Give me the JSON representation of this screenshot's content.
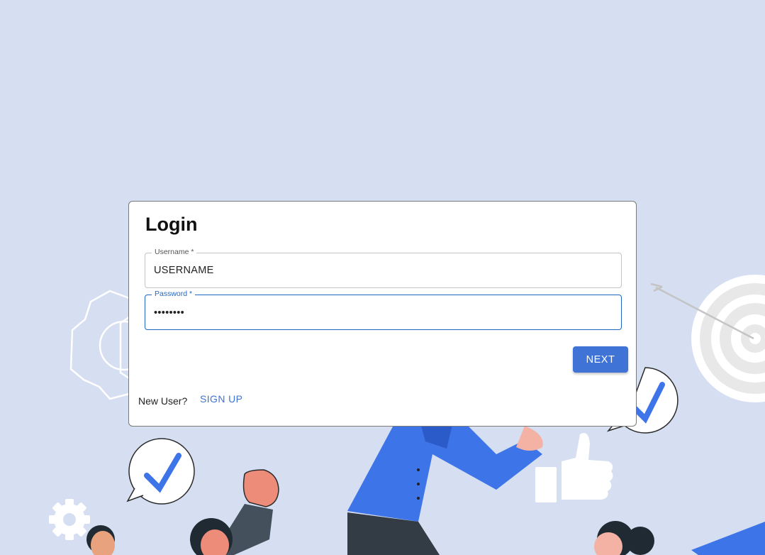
{
  "colors": {
    "background": "#d6def2",
    "accent": "#3f74d6",
    "focus": "#1f66c4",
    "card": "#ffffff",
    "shirt": "#3d74e8"
  },
  "login": {
    "title": "Login",
    "username": {
      "label": "Username *",
      "value": "USERNAME"
    },
    "password": {
      "label": "Password *",
      "value": "••••••••"
    },
    "next_label": "NEXT",
    "new_user_text": "New User?",
    "signup_label": "SIGN UP"
  },
  "illustration": {
    "icons": [
      "gear-icon",
      "target-icon",
      "arrow-icon",
      "check-bubble-icon",
      "thumbs-up-icon",
      "person-icon",
      "raised-fist-icon"
    ]
  }
}
